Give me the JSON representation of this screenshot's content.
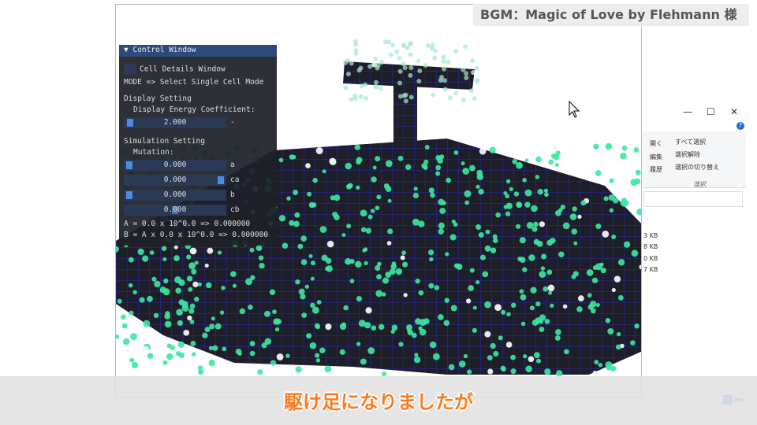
{
  "explorer": {
    "ribbon": [
      "開く",
      "編集",
      "履歴"
    ],
    "select_items": [
      "すべて選択",
      "選択解除",
      "選択の切り替え"
    ],
    "group_label": "選択",
    "sizes": [
      "3 KB",
      "8 KB",
      "0 KB",
      "7 KB"
    ]
  },
  "control_window": {
    "title": "Control Window",
    "cell_details": "Cell Details Window",
    "mode": "MODE => Select Single Cell Mode",
    "display_header": "Display Setting",
    "energy_label": "Display Energy Coefficient:",
    "energy_value": "2.000",
    "energy_suffix": "-",
    "sim_header": "Simulation Setting",
    "mutation_label": "Mutation:",
    "sliders": [
      {
        "value": "0.000",
        "label": "a",
        "fill": 0
      },
      {
        "value": "0.000",
        "label": "ca",
        "fill": 1
      },
      {
        "value": "0.000",
        "label": "b",
        "fill": 0
      },
      {
        "value": "0.000",
        "label": "cb",
        "fill": 0.45
      }
    ],
    "formula_a": "A = 0.0 x 10^0.0 => 0.000000",
    "formula_b": "B = A x 0.0 x 10^0.0 => 0.000000"
  },
  "bgm": "BGM：Magic of Love by Flehmann 様",
  "subtitle": "駆け足になりましたが",
  "colors": {
    "cell": "#3ce8a0",
    "grid": "#2a2aa8",
    "block": "#1e1e2a",
    "accent": "#ff7a1a"
  }
}
